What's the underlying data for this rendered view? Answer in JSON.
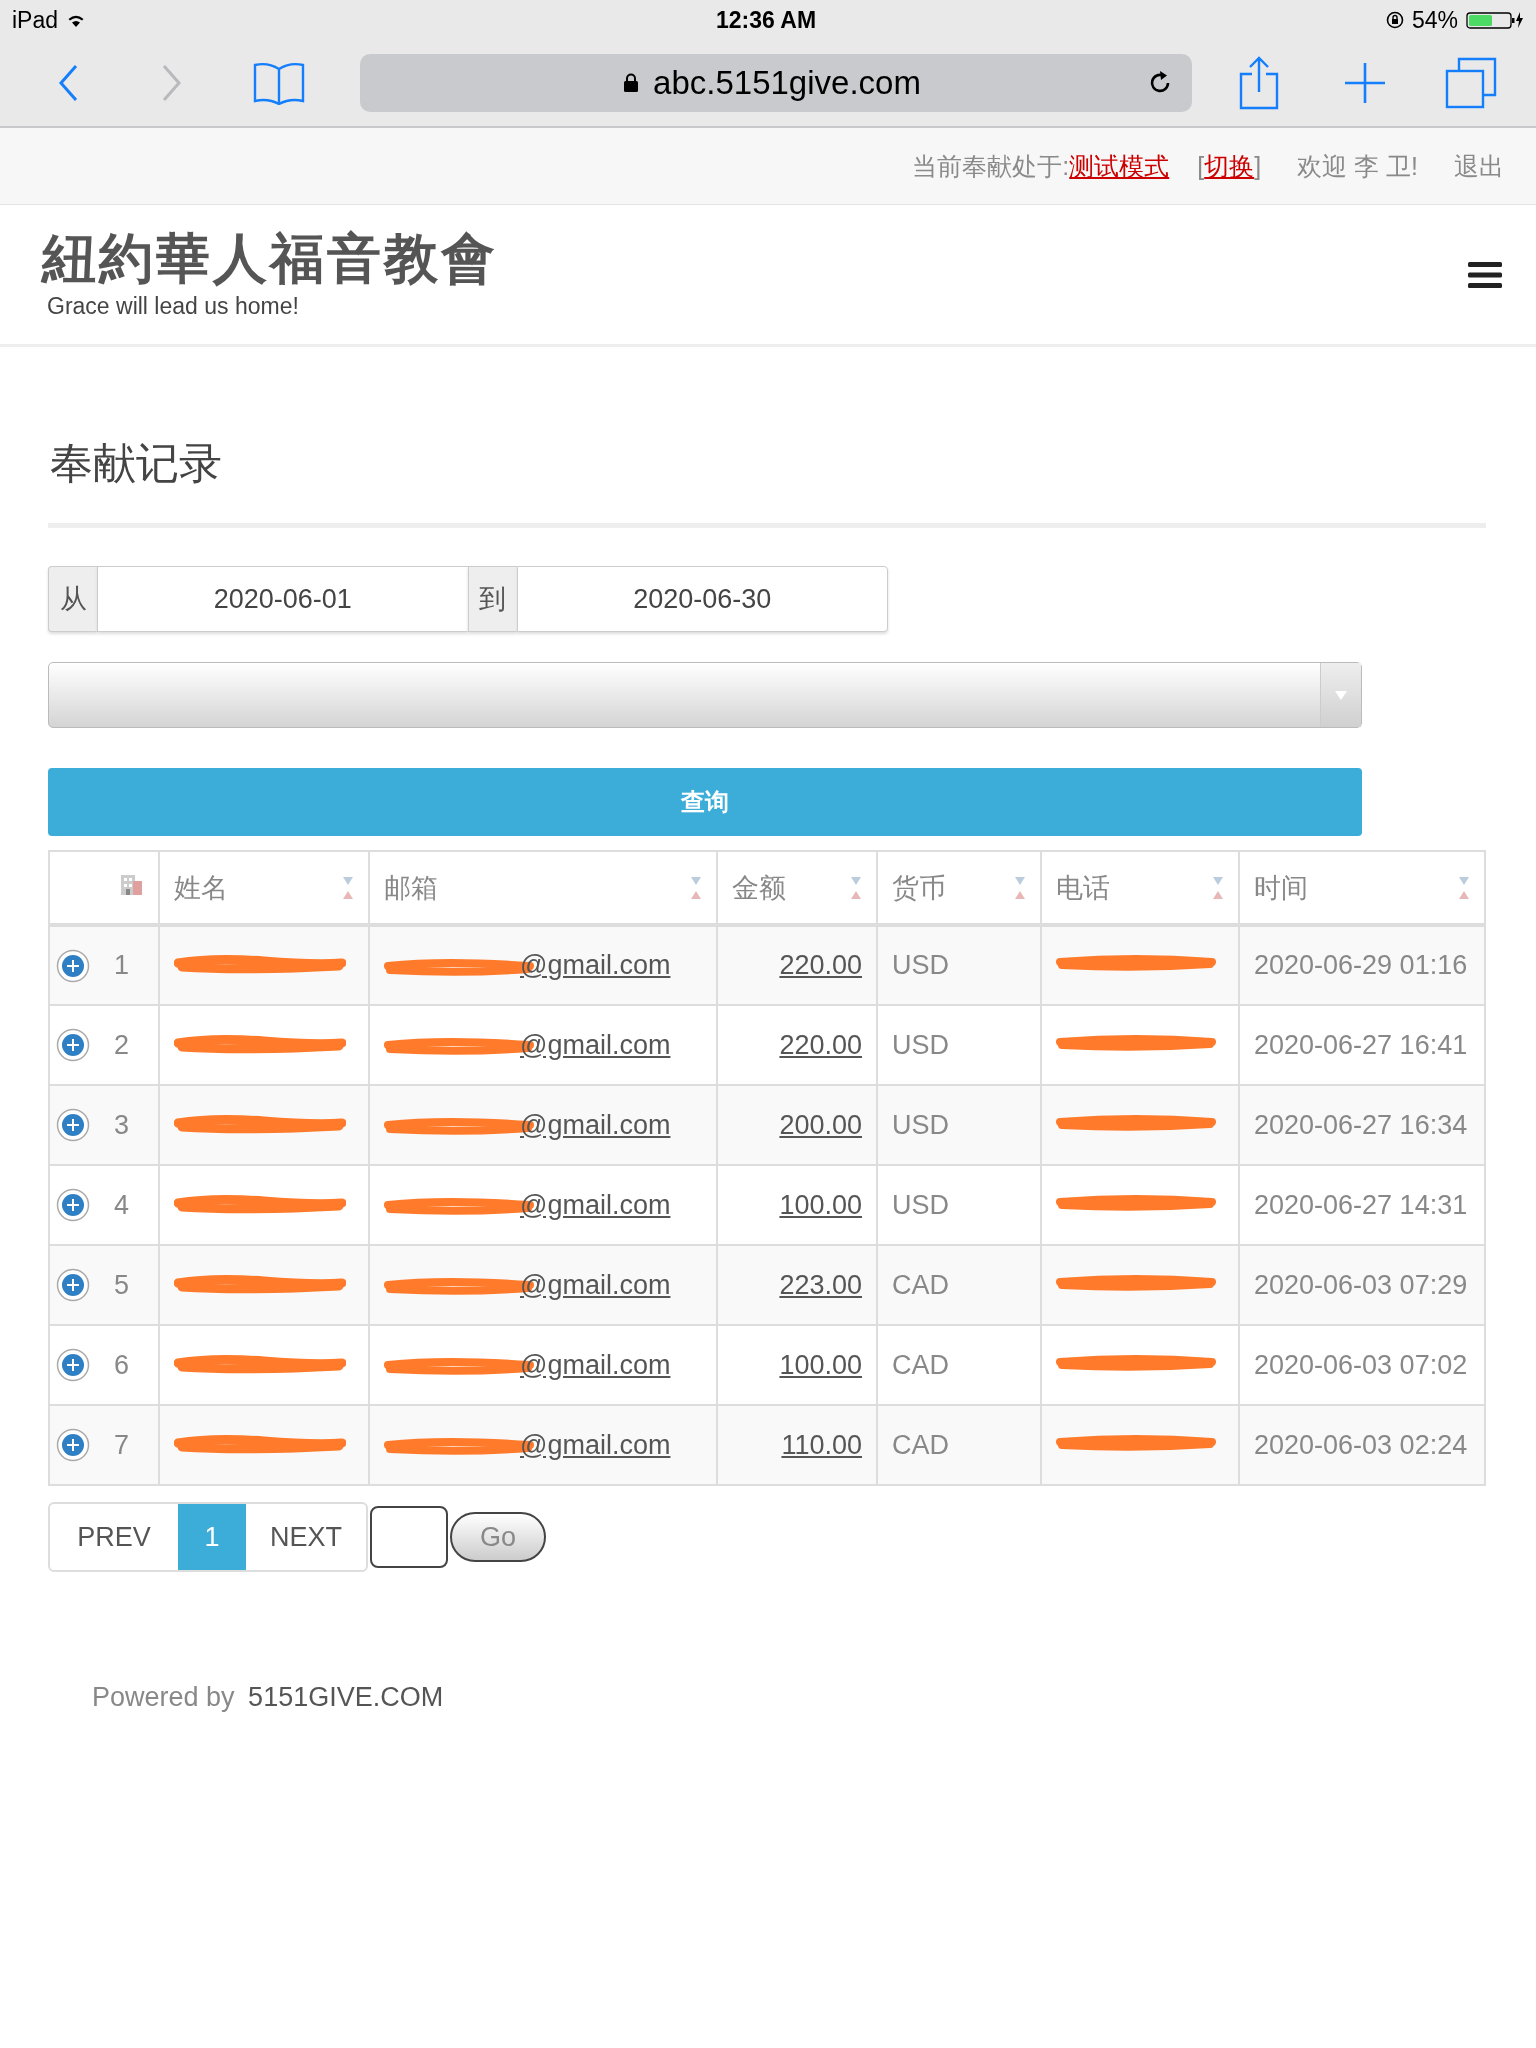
{
  "status_bar": {
    "device": "iPad",
    "time": "12:36 AM",
    "battery": "54%"
  },
  "browser": {
    "url": "abc.5151give.com"
  },
  "top_bar": {
    "mode_label": "当前奉献处于:",
    "mode_link": "测试模式",
    "switch_open": "[",
    "switch_link": "切换",
    "switch_close": "]",
    "welcome": "欢迎 李 卫!",
    "logout": "退出"
  },
  "site": {
    "title": "紐約華人福音教會",
    "tagline": "Grace will lead us home!"
  },
  "page_title": "奉献记录",
  "filter": {
    "from_label": "从",
    "from_value": "2020-06-01",
    "to_label": "到",
    "to_value": "2020-06-30",
    "query_button": "查询"
  },
  "table": {
    "columns": [
      "姓名",
      "邮箱",
      "金额",
      "货币",
      "电话",
      "时间"
    ],
    "rows": [
      {
        "index": "1",
        "email": "@gmail.com",
        "amount": "220.00",
        "currency": "USD",
        "time": "2020-06-29 01:16"
      },
      {
        "index": "2",
        "email": "@gmail.com",
        "amount": "220.00",
        "currency": "USD",
        "time": "2020-06-27 16:41"
      },
      {
        "index": "3",
        "email": "@gmail.com",
        "amount": "200.00",
        "currency": "USD",
        "time": "2020-06-27 16:34"
      },
      {
        "index": "4",
        "email": "@gmail.com",
        "amount": "100.00",
        "currency": "USD",
        "time": "2020-06-27 14:31"
      },
      {
        "index": "5",
        "email": "@gmail.com",
        "amount": "223.00",
        "currency": "CAD",
        "time": "2020-06-03 07:29"
      },
      {
        "index": "6",
        "email": "@gmail.com",
        "amount": "100.00",
        "currency": "CAD",
        "time": "2020-06-03 07:02"
      },
      {
        "index": "7",
        "email": "@gmail.com",
        "amount": "110.00",
        "currency": "CAD",
        "time": "2020-06-03 02:24"
      }
    ]
  },
  "pagination": {
    "prev": "PREV",
    "pages": [
      {
        "label": "1",
        "selected": true
      }
    ],
    "next": "NEXT",
    "go": "Go"
  },
  "footer": {
    "prefix": "Powered by",
    "brand": "5151GIVE.COM"
  }
}
